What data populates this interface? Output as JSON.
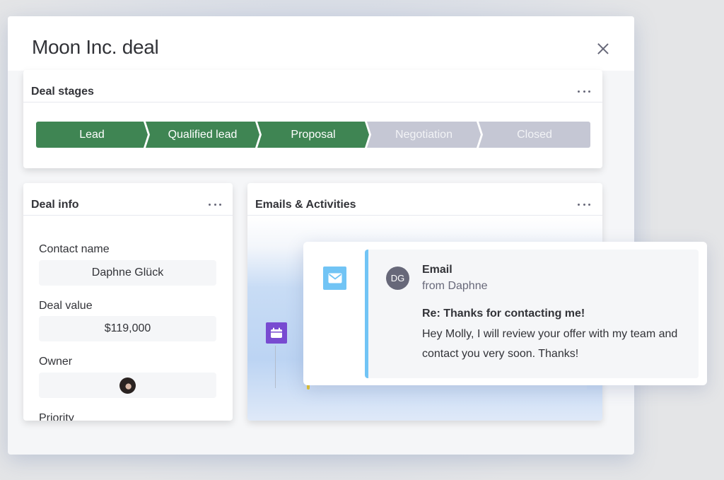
{
  "modal": {
    "title": "Moon Inc. deal",
    "close_icon": "close-icon"
  },
  "deal_stages": {
    "title": "Deal stages",
    "menu_icon": "more-dots-icon",
    "colors": {
      "completed": "#3f8553",
      "pending": "#c5c7d4"
    },
    "stages": [
      {
        "label": "Lead",
        "status": "completed"
      },
      {
        "label": "Qualified lead",
        "status": "completed"
      },
      {
        "label": "Proposal",
        "status": "completed"
      },
      {
        "label": "Negotiation",
        "status": "pending"
      },
      {
        "label": "Closed",
        "status": "pending"
      }
    ]
  },
  "deal_info": {
    "title": "Deal info",
    "menu_icon": "more-dots-icon",
    "fields": [
      {
        "label": "Contact name",
        "value": "Daphne Glück"
      },
      {
        "label": "Deal value",
        "value": "$119,000"
      },
      {
        "label": "Owner",
        "value": "owner-avatar"
      },
      {
        "label": "Priority",
        "value": ""
      }
    ]
  },
  "emails_activities": {
    "title": "Emails & Activities",
    "menu_icon": "more-dots-icon",
    "timeline_icons": [
      "mail-icon",
      "calendar-icon"
    ],
    "accent_colors": {
      "email": "#71c4f5",
      "meeting": "#784bd1",
      "other": "#e2c32e"
    }
  },
  "email_popup": {
    "sender_initials": "DG",
    "type": "Email",
    "from": "from Daphne",
    "subject": "Re: Thanks for contacting me!",
    "body": "Hey Molly, I will review your offer with my team and contact you very soon. Thanks!"
  }
}
